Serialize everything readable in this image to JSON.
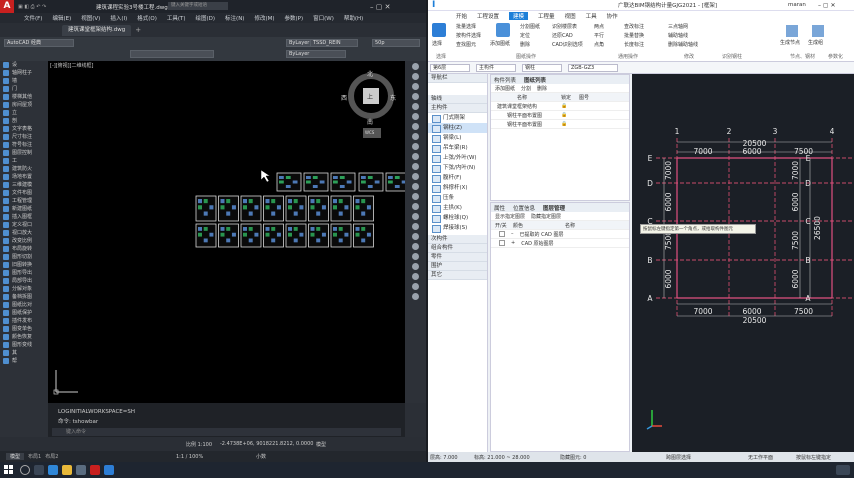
{
  "acad": {
    "logo": "A",
    "title": "建筑课程实验3号楼工程.dwg",
    "search_placeholder": "键入关键字或短语",
    "menu": [
      "文件(F)",
      "编辑(E)",
      "视图(V)",
      "插入(I)",
      "格式(O)",
      "工具(T)",
      "绘图(D)",
      "标注(N)",
      "修改(M)",
      "参数(P)",
      "窗口(W)",
      "帮助(H)"
    ],
    "tabs": [
      "建筑课堂框架结构.dwg"
    ],
    "workspace": "AutoCAD 经典",
    "layer": "ByLayer",
    "style_a": "TSSD_REIN",
    "style_b": "50p",
    "viewport_label": "[-][俯视][二维线框]",
    "left_panel": [
      "设",
      "轴网柱子",
      "墙",
      "门",
      "楼梯其他",
      "房间屋顶",
      "立",
      "剖",
      "文字表格",
      "尺寸标注",
      "符号标注",
      "图层控制",
      "工",
      "建筑防火",
      "场地布置",
      "三维建模",
      "文件布图",
      "工程管理",
      "新建图纸",
      "插入图框",
      "定义视口",
      "视口放大",
      "改变比例",
      "布局旋转",
      "图形切割",
      "旧图转换",
      "图形导出",
      "局部导出",
      "分解对象",
      "备档拆图",
      "图纸比对",
      "图纸保护",
      "插件发布",
      "图变单色",
      "颜色恢复",
      "图形变线",
      "其",
      "帮"
    ],
    "compass": {
      "n": "北",
      "s": "南",
      "e": "东",
      "w": "西",
      "center": "上",
      "wcs": "WCS"
    },
    "cmd_lines": [
      "LOGINITIALWORKSPACE=SH",
      "命令: tshowbar"
    ],
    "cmd_placeholder": "键入命令",
    "status_scale": "比例 1:100",
    "status_coords": "-2.4738E+06, 9018221.8212, 0.0000",
    "status_model": "模型",
    "status_zoom": "1:1 / 100%",
    "status_unit": "小数",
    "layouts": [
      "模型",
      "布局1",
      "布局2"
    ]
  },
  "gld": {
    "title": "广联达BIM钢结构计量GJG2021 - [框架]",
    "user": "maran",
    "tabs": [
      "开始",
      "工程设置",
      "建模",
      "工程量",
      "视图",
      "工具",
      "协作"
    ],
    "ribbon": {
      "select": "选择",
      "col1": [
        "批量选择",
        "按构件选择",
        "查找图元"
      ],
      "add_drawing": "添加图纸",
      "col2": [
        "分割图纸",
        "定位",
        "删除"
      ],
      "col3": [
        "识别楼层表",
        "还原CAD",
        "CAD识别选项"
      ],
      "col4": [
        "两点",
        "平行",
        "点角"
      ],
      "col5": [
        "查改标注",
        "批量替换",
        "长度标注"
      ],
      "col6": [
        "三点轴网",
        "辅助轴线",
        "删除辅助轴线"
      ],
      "groups": [
        "选择",
        "图纸操作",
        "通用操作",
        "修改",
        "识别钢柱"
      ],
      "right": [
        "生成节点",
        "生成组",
        "节点、钢材",
        "参数化"
      ]
    },
    "floor_bar": [
      "第6层",
      "主构件",
      "钢柱",
      "ZGB-GZ3"
    ],
    "nav": {
      "title": "导航栏",
      "sections": [
        "轴线",
        "主构件"
      ],
      "items": [
        "门式刚架",
        "钢柱(Z)",
        "钢梁(L)",
        "吊车梁(R)",
        "上弦/外叶(W)",
        "下弦/内叶(N)",
        "腹杆(F)",
        "斜撑杆(X)",
        "压条",
        "主拱(K)",
        "螺栓球(Q)",
        "焊接球(S)"
      ],
      "foot": [
        "次构件",
        "组合构件",
        "零件",
        "围护",
        "其它"
      ]
    },
    "plist": {
      "tabs": [
        "构件列表",
        "图纸列表"
      ],
      "toolbar": [
        "添加图纸",
        "分割",
        "删除"
      ],
      "cols": [
        "名称",
        "锁定",
        "图号"
      ],
      "rows": [
        "建筑课堂框架结构",
        "钢柱平面布置图",
        "钢柱平面布置图"
      ]
    },
    "plist2": {
      "tabs": [
        "属性",
        "位置信息",
        "图层管理"
      ],
      "filters": [
        "显示指定图层",
        "隐藏指定图层"
      ],
      "cols": [
        "开/关",
        "颜色",
        "名称"
      ],
      "rows": [
        "已提取的 CAD 图层",
        "CAD 原始图层"
      ]
    },
    "grid": {
      "cols": [
        "1",
        "2",
        "3",
        "4"
      ],
      "rows": [
        "A",
        "B",
        "C",
        "D",
        "E"
      ],
      "spans_x": [
        "7000",
        "6000",
        "7500"
      ],
      "total_x": "20500",
      "spans_y": [
        "6000",
        "7500",
        "6000",
        "7000"
      ],
      "total_y": "26500",
      "tooltip": "按鼠标左键指定第一个角点，或拾取构件图元"
    },
    "status": {
      "floor_h": "层高: 7.000",
      "base": "标高: 21.000 ~ 28.000",
      "hidden": "隐藏图元: 0",
      "right": "跨图层选择",
      "mode": "无工作平面",
      "hint": "按鼠标左键指定"
    }
  },
  "taskbar": {
    "time": "",
    "icons": [
      "start",
      "search",
      "taskview",
      "edge",
      "explorer",
      "store",
      "acad",
      "gld"
    ]
  }
}
